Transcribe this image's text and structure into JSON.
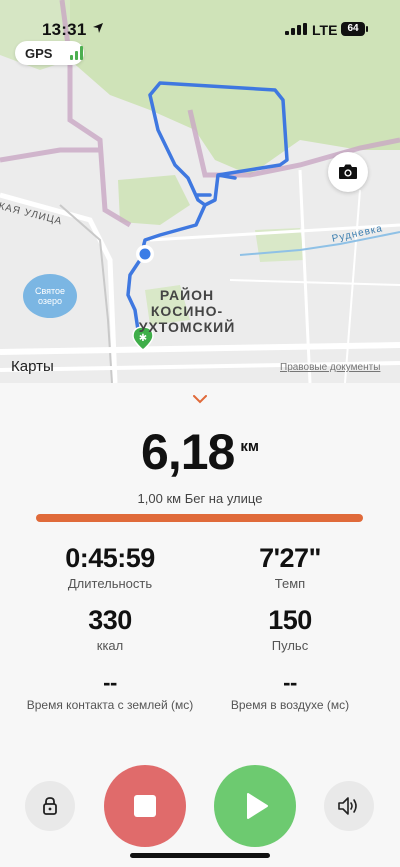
{
  "status_bar": {
    "time": "13:31",
    "network": "LTE",
    "battery": "64"
  },
  "map": {
    "gps_label": "GPS",
    "labels": {
      "street": "КАЯ УЛИЦА",
      "river": "Рудневка",
      "lake_line1": "Святое",
      "lake_line2": "озеро",
      "district_line1": "РАЙОН",
      "district_line2": "КОСИНО-",
      "district_line3": "УХТОМСКИЙ"
    },
    "maps_brand": "Карты",
    "legal_link": "Правовые документы"
  },
  "workout": {
    "distance_value": "6,18",
    "distance_unit": "км",
    "subtitle": "1,00 км Бег на улице",
    "progress": 1.0,
    "accent_color": "#e06a3a",
    "metrics": [
      {
        "value": "0:45:59",
        "label": "Длительность"
      },
      {
        "value": "7'27\"",
        "label": "Темп"
      },
      {
        "value": "330",
        "label": "ккал"
      },
      {
        "value": "150",
        "label": "Пульс"
      },
      {
        "value": "--",
        "label": "Время контакта с землей (мс)"
      },
      {
        "value": "--",
        "label": "Время в воздухе (мс)"
      }
    ]
  },
  "controls": {
    "lock": "lock-icon",
    "stop": "stop-icon",
    "play": "play-icon",
    "sound": "speaker-icon",
    "stop_color": "#e06b6b",
    "play_color": "#6dca70"
  }
}
